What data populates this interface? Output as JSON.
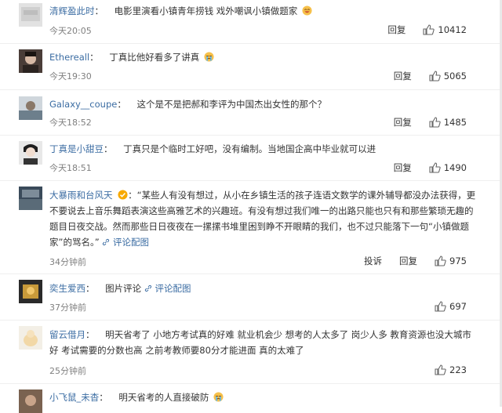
{
  "reply_label": "回复",
  "report_label": "投诉",
  "comments": [
    {
      "user": "清辉盈此时",
      "sep": "：",
      "text": "电影里演看小镇青年捞钱 戏外嘲讽小镇做题家",
      "time": "今天20:05",
      "likes": "10412",
      "emoji": "laugh-emoji"
    },
    {
      "user": "Ethereall",
      "sep": "：",
      "text": "丁真比他好看多了讲真",
      "time": "今天19:30",
      "likes": "5065",
      "emoji": "cry-emoji"
    },
    {
      "user": "Galaxy__coupe",
      "sep": "：",
      "text": "这个是不是把郝和李评为中国杰出女性的那个？",
      "time": "今天18:52",
      "likes": "1485"
    },
    {
      "user": "丁真是小甜豆",
      "sep": "：",
      "text": "丁真只是个临时工好吧，没有编制。当地国企高中毕业就可以进",
      "time": "今天18:51",
      "likes": "1490"
    },
    {
      "user": "大暴雨和台风天",
      "sep": "：",
      "text": "“某些人有没有想过，从小在乡镇生活的孩子连语文数学的课外辅导都没办法获得，更不要说去上音乐舞蹈表演这些高雅艺术的兴趣班。有没有想过我们唯一的出路只能也只有和那些繁琐无趣的题目日夜交战。然而那些日日夜夜在一摞摞书堆里困到睁不开眼睛的我们，也不过只能落下一句“小镇做题家”的骂名。”",
      "link": "评论配图",
      "time": "34分钟前",
      "likes": "975",
      "verified": "verified-badge-icon"
    },
    {
      "user": "奕生爱西",
      "sep": "：",
      "text": "图片评论",
      "link": "评论配图",
      "time": "37分钟前",
      "likes": "697"
    },
    {
      "user": "留云借月",
      "sep": "：",
      "text": "明天省考了 小地方考试真的好难 就业机会少 想考的人太多了 岗少人多 教育资源也没大城市好 考试需要的分数也高 之前考教师要80分才能进面 真的太难了",
      "time": "25分钟前",
      "likes": "223"
    },
    {
      "user": "小飞鼠_未杳",
      "sep": "：",
      "text": "明天省考的人直接破防",
      "emoji": "cry-emoji"
    }
  ],
  "colors": {
    "user_link": "#3c6da3",
    "time": "#808080",
    "divider": "#efefef"
  }
}
